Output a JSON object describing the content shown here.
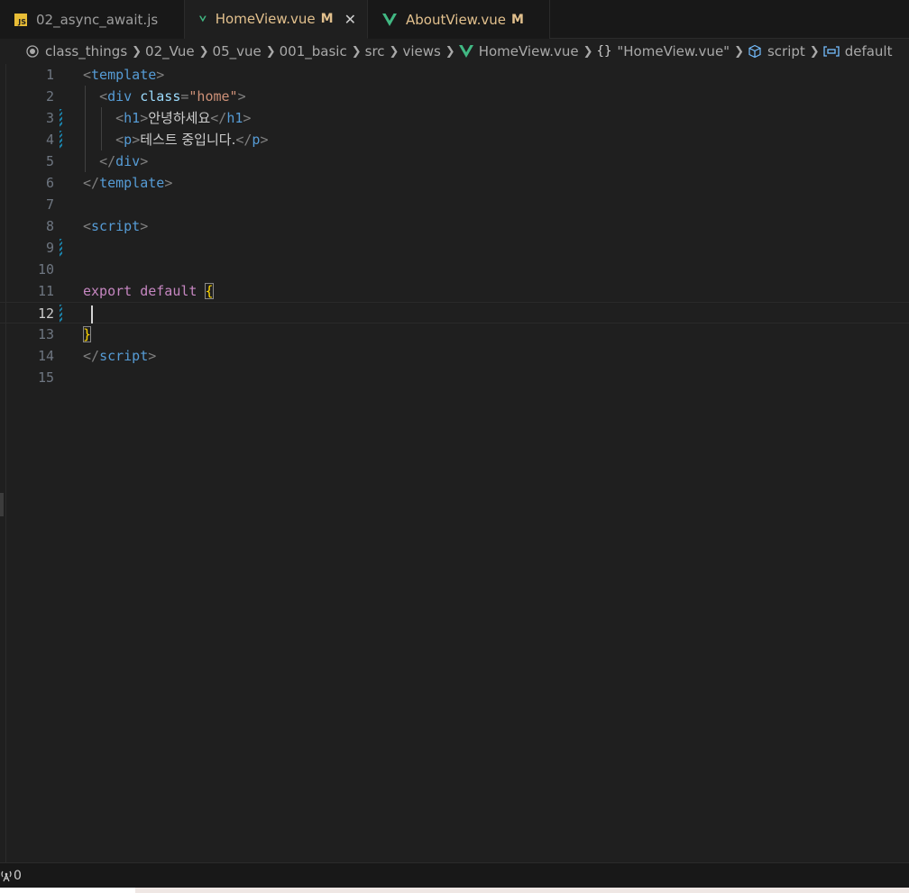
{
  "tabs": [
    {
      "label": "02_async_await.js",
      "icon": "js-icon",
      "modified": ""
    },
    {
      "label": "HomeView.vue",
      "icon": "vue-icon",
      "modified": "M",
      "active": true
    },
    {
      "label": "AboutView.vue",
      "icon": "vue-icon",
      "modified": "M"
    }
  ],
  "breadcrumb": {
    "items": [
      "class_things",
      "02_Vue",
      "05_vue",
      "001_basic",
      "src",
      "views",
      "HomeView.vue",
      "\"HomeView.vue\"",
      "script",
      "default"
    ]
  },
  "editor": {
    "line_numbers": [
      "1",
      "2",
      "3",
      "4",
      "5",
      "6",
      "7",
      "8",
      "9",
      "10",
      "11",
      "12",
      "13",
      "14",
      "15"
    ],
    "current_line": 12,
    "code": {
      "l1_tag": "template",
      "l2_tag": "div",
      "l2_attr": "class",
      "l2_val": "\"home\"",
      "l3_tag": "h1",
      "l3_text": "안녕하세요",
      "l4_tag": "p",
      "l4_text": "테스트 중입니다.",
      "l5_tag": "div",
      "l6_tag": "template",
      "l8_tag": "script",
      "l11_kw1": "export",
      "l11_kw2": "default",
      "l11_brace": "{",
      "l13_brace": "}",
      "l14_tag": "script"
    }
  },
  "statusbar": {
    "ports_count": "0"
  },
  "colors": {
    "modified": "#e2c08d",
    "vue": "#41b883",
    "tag": "#569cd6",
    "attr": "#9cdcfe",
    "string": "#ce9178",
    "keyword": "#c586c0"
  }
}
